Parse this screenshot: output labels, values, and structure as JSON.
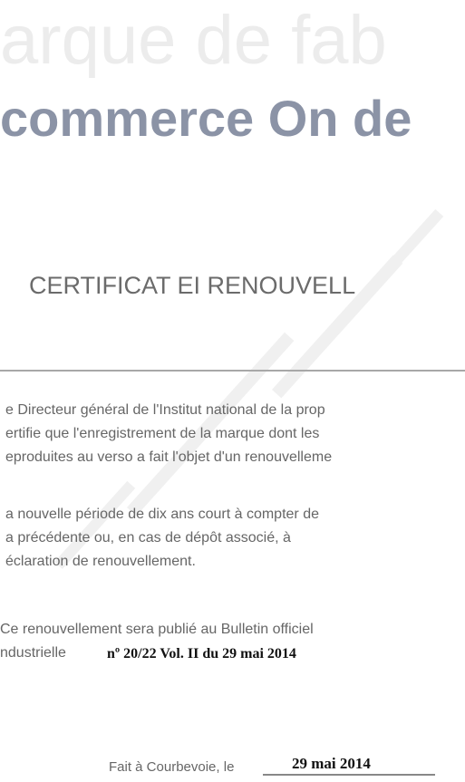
{
  "header": {
    "line1": "arque de fab",
    "line2": "commerce On de"
  },
  "title": "CERTIFICAT EI RENOUVELL",
  "paragraphs": [
    [
      "e Directeur général de l'Institut national de la prop",
      "ertifie que l'enregistrement de la marque dont les",
      "eproduites au verso a fait l'objet d'un renouvelleme"
    ],
    [
      "a nouvelle période de dix ans court à compter de",
      "a précédente ou, en cas de dépôt associé, à",
      "éclaration de renouvellement."
    ],
    [
      "Ce renouvellement sera publié au Bulletin officiel",
      "ndustrielle"
    ]
  ],
  "bulletin_ref": "nº 20/22 Vol. II du 29 mai 2014",
  "signature": {
    "label": "Fait à Courbevoie, le",
    "date": "29 mai 2014"
  },
  "watermark_color": "#f0f0f0"
}
